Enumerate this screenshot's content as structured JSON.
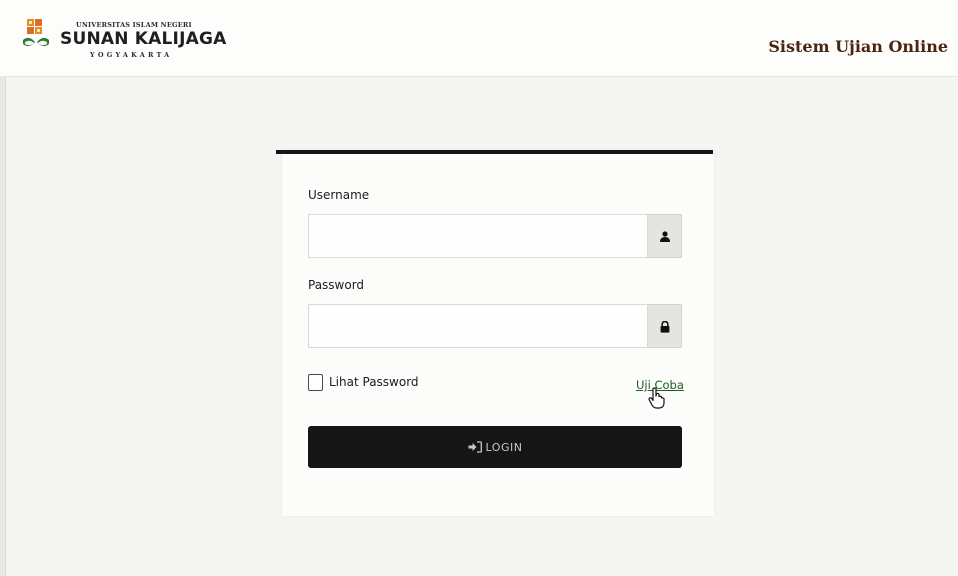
{
  "header": {
    "logo_small": "UNIVERSITAS ISLAM NEGERI",
    "logo_main": "SUNAN KALIJAGA",
    "logo_city": "YOGYAKARTA",
    "app_title": "Sistem Ujian Online"
  },
  "form": {
    "username_label": "Username",
    "username_value": "",
    "password_label": "Password",
    "password_value": "",
    "show_password_label": "Lihat Password",
    "show_password_checked": false,
    "trial_link": "Uji Coba",
    "login_label": "LOGIN"
  },
  "icons": {
    "username_addon": "user-icon",
    "password_addon": "lock-icon",
    "login": "sign-in-icon",
    "cursor": "hand-pointer-icon"
  },
  "colors": {
    "accent_dark": "#151515",
    "title_brown": "#4a2612",
    "link_green": "#1e5a24",
    "logo_orange": "#e8892a",
    "logo_green": "#2f7a35"
  }
}
